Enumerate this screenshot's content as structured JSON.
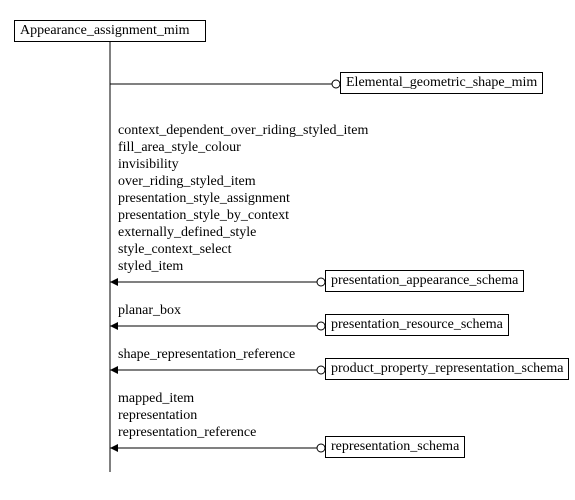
{
  "root": {
    "label": "Appearance_assignment_mim"
  },
  "targets": [
    {
      "label": "Elemental_geometric_shape_mim"
    },
    {
      "label": "presentation_appearance_schema"
    },
    {
      "label": "presentation_resource_schema"
    },
    {
      "label": "product_property_representation_schema"
    },
    {
      "label": "representation_schema"
    }
  ],
  "groups": [
    {
      "items": []
    },
    {
      "items": [
        "context_dependent_over_riding_styled_item",
        "fill_area_style_colour",
        "invisibility",
        "over_riding_styled_item",
        "presentation_style_assignment",
        "presentation_style_by_context",
        "externally_defined_style",
        "style_context_select",
        "styled_item"
      ]
    },
    {
      "items": [
        "planar_box"
      ]
    },
    {
      "items": [
        "shape_representation_reference"
      ]
    },
    {
      "items": [
        "mapped_item",
        "representation",
        "representation_reference"
      ]
    }
  ]
}
